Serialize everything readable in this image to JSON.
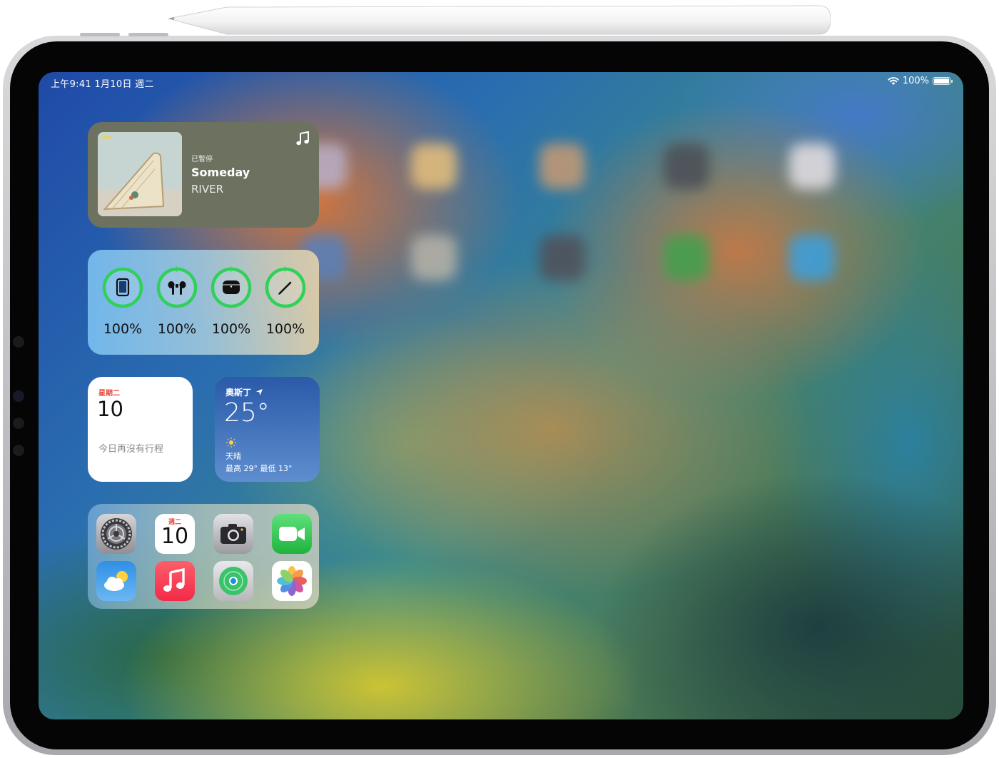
{
  "status_bar": {
    "time_date": "上午9:41   1月10日 週二",
    "battery_percent": "100%",
    "wifi_icon": "wifi-icon",
    "battery_icon": "battery-icon"
  },
  "music_widget": {
    "status": "已暫停",
    "song": "Someday",
    "artist": "RIVER",
    "icon": "music-note-icon"
  },
  "batteries_widget": {
    "devices": [
      {
        "device": "ipad",
        "icon": "ipad-icon",
        "percent": "100%",
        "level": 1.0,
        "charging": false
      },
      {
        "device": "airpods",
        "icon": "airpods-icon",
        "percent": "100%",
        "level": 1.0,
        "charging": true
      },
      {
        "device": "airpods-case",
        "icon": "airpods-case-icon",
        "percent": "100%",
        "level": 1.0,
        "charging": true
      },
      {
        "device": "apple-pencil",
        "icon": "pencil-icon",
        "percent": "100%",
        "level": 1.0,
        "charging": true
      }
    ],
    "ring_color": "#30d158"
  },
  "calendar_widget": {
    "weekday": "星期二",
    "day": "10",
    "no_events": "今日再沒有行程",
    "accent": "#e8453c"
  },
  "weather_widget": {
    "city": "奧斯丁",
    "temperature": "25°",
    "condition": "天晴",
    "high_low": "最高 29° 最低 13°",
    "icons": [
      "location-arrow-icon",
      "sun-icon"
    ]
  },
  "app_grid": {
    "apps": [
      "settings",
      "calendar",
      "camera",
      "facetime",
      "weather",
      "music",
      "find-my",
      "photos"
    ],
    "calendar_icon": {
      "weekday": "週二",
      "day": "10"
    }
  }
}
